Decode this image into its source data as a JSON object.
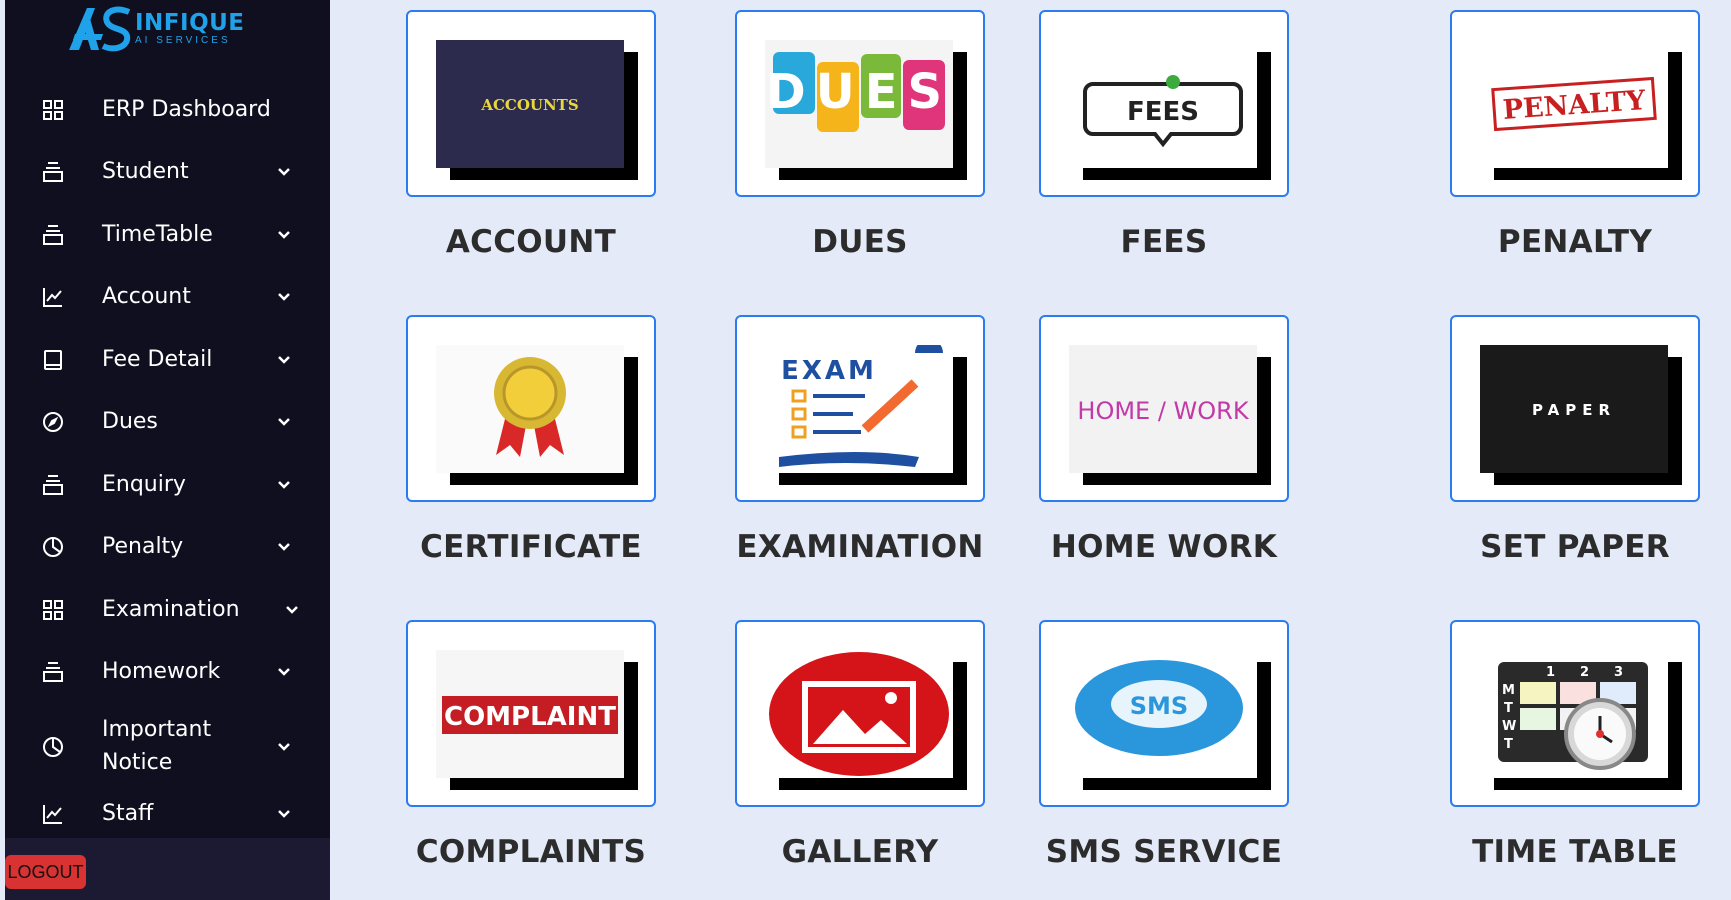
{
  "brand": {
    "name": "INFIQUE",
    "tagline": "AI SERVICES",
    "color": "#1fa2ea"
  },
  "sidebar": {
    "items": [
      {
        "label": "ERP Dashboard",
        "icon": "grid-icon",
        "has_chevron": false
      },
      {
        "label": "Student",
        "icon": "stack-icon",
        "has_chevron": true
      },
      {
        "label": "TimeTable",
        "icon": "stack-icon",
        "has_chevron": true
      },
      {
        "label": "Account",
        "icon": "line-chart-icon",
        "has_chevron": true
      },
      {
        "label": "Fee Detail",
        "icon": "book-icon",
        "has_chevron": true
      },
      {
        "label": "Dues",
        "icon": "compass-icon",
        "has_chevron": true
      },
      {
        "label": "Enquiry",
        "icon": "stack-icon",
        "has_chevron": true
      },
      {
        "label": "Penalty",
        "icon": "pie-chart-icon",
        "has_chevron": true
      },
      {
        "label": "Examination",
        "icon": "grid-icon",
        "has_chevron": true
      },
      {
        "label": "Homework",
        "icon": "stack-icon",
        "has_chevron": true
      },
      {
        "label": "Important Notice",
        "icon": "pie-chart-icon",
        "has_chevron": true
      },
      {
        "label": "Staff",
        "icon": "line-chart-icon",
        "has_chevron": true
      }
    ],
    "logout_label": "LOGOUT"
  },
  "tiles": [
    {
      "label": "ACCOUNT",
      "image_text": "ACCOUNTS",
      "image": "accounts-book"
    },
    {
      "label": "DUES",
      "image_text": "DUES",
      "image": "dues-bubbles"
    },
    {
      "label": "FEES",
      "image_text": "FEES",
      "image": "fees-speech"
    },
    {
      "label": "PENALTY",
      "image_text": "PENALTY",
      "image": "penalty-stamp"
    },
    {
      "label": "CERTIFICATE",
      "image_text": "",
      "image": "award-medal"
    },
    {
      "label": "EXAMINATION",
      "image_text": "EXAM",
      "image": "exam-checklist"
    },
    {
      "label": "HOME WORK",
      "image_text": "HOME / WORK",
      "image": "homework-text"
    },
    {
      "label": "SET PAPER",
      "image_text": "PAPER",
      "image": "paper-card"
    },
    {
      "label": "COMPLAINTS",
      "image_text": "COMPLAINT",
      "image": "complaint-stamp"
    },
    {
      "label": "GALLERY",
      "image_text": "",
      "image": "gallery-photo"
    },
    {
      "label": "SMS SERVICE",
      "image_text": "SMS",
      "image": "sms-bubble"
    },
    {
      "label": "TIME TABLE",
      "image_text": "",
      "image": "calendar-clock"
    }
  ],
  "colors": {
    "sidebar_bg": "#0f0f1f",
    "page_bg": "#e4eaf7",
    "tile_border": "#2a7cf0",
    "logout": "#d83232"
  }
}
